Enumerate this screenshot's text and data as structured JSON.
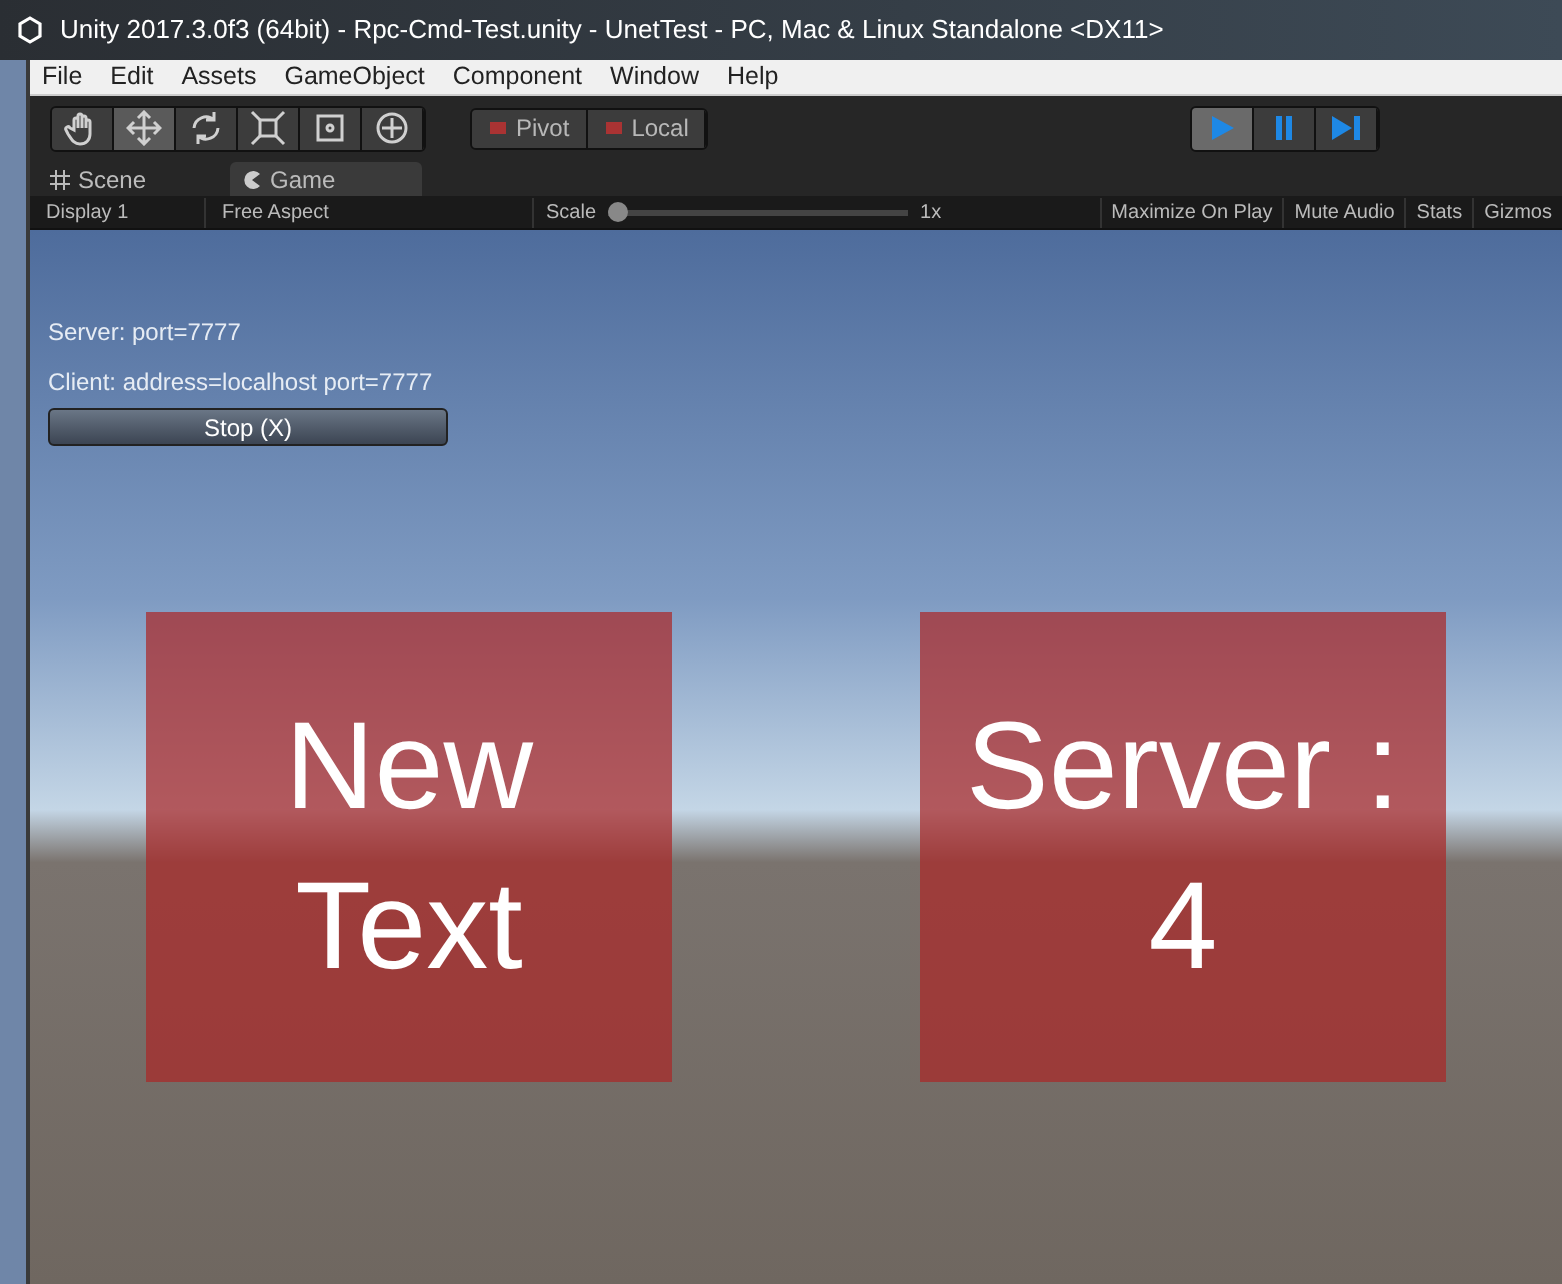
{
  "window": {
    "title": "Unity 2017.3.0f3 (64bit) - Rpc-Cmd-Test.unity - UnetTest - PC, Mac & Linux Standalone <DX11>"
  },
  "menu": [
    "File",
    "Edit",
    "Assets",
    "GameObject",
    "Component",
    "Window",
    "Help"
  ],
  "tools": [
    {
      "kind": "hand",
      "selected": false
    },
    {
      "kind": "move",
      "selected": true
    },
    {
      "kind": "rotate",
      "selected": false
    },
    {
      "kind": "scale",
      "selected": false
    },
    {
      "kind": "rect",
      "selected": false
    },
    {
      "kind": "transform",
      "selected": false
    }
  ],
  "pivot_buttons": [
    "Pivot",
    "Local"
  ],
  "play_controls": [
    {
      "kind": "play",
      "selected": true
    },
    {
      "kind": "pause",
      "selected": false
    },
    {
      "kind": "step",
      "selected": false
    }
  ],
  "tabs": [
    {
      "label": "Scene",
      "kind": "grid",
      "selected": false
    },
    {
      "label": "Game",
      "kind": "pacman",
      "selected": true
    }
  ],
  "game_toolbar": {
    "display": "Display 1",
    "aspect": "Free Aspect",
    "scale_label": "Scale",
    "scale": {
      "level": 0
    },
    "scale_reading": "1x",
    "buttons": [
      "Maximize On Play",
      "Mute Audio",
      "Stats",
      "Gizmos"
    ]
  },
  "game_view": {
    "lines": [
      "Server: port=7777",
      "Client: address=localhost port=7777"
    ],
    "button": "Stop (X)",
    "panels": [
      {
        "text": "New Text"
      },
      {
        "text": "Server : 4"
      }
    ]
  }
}
